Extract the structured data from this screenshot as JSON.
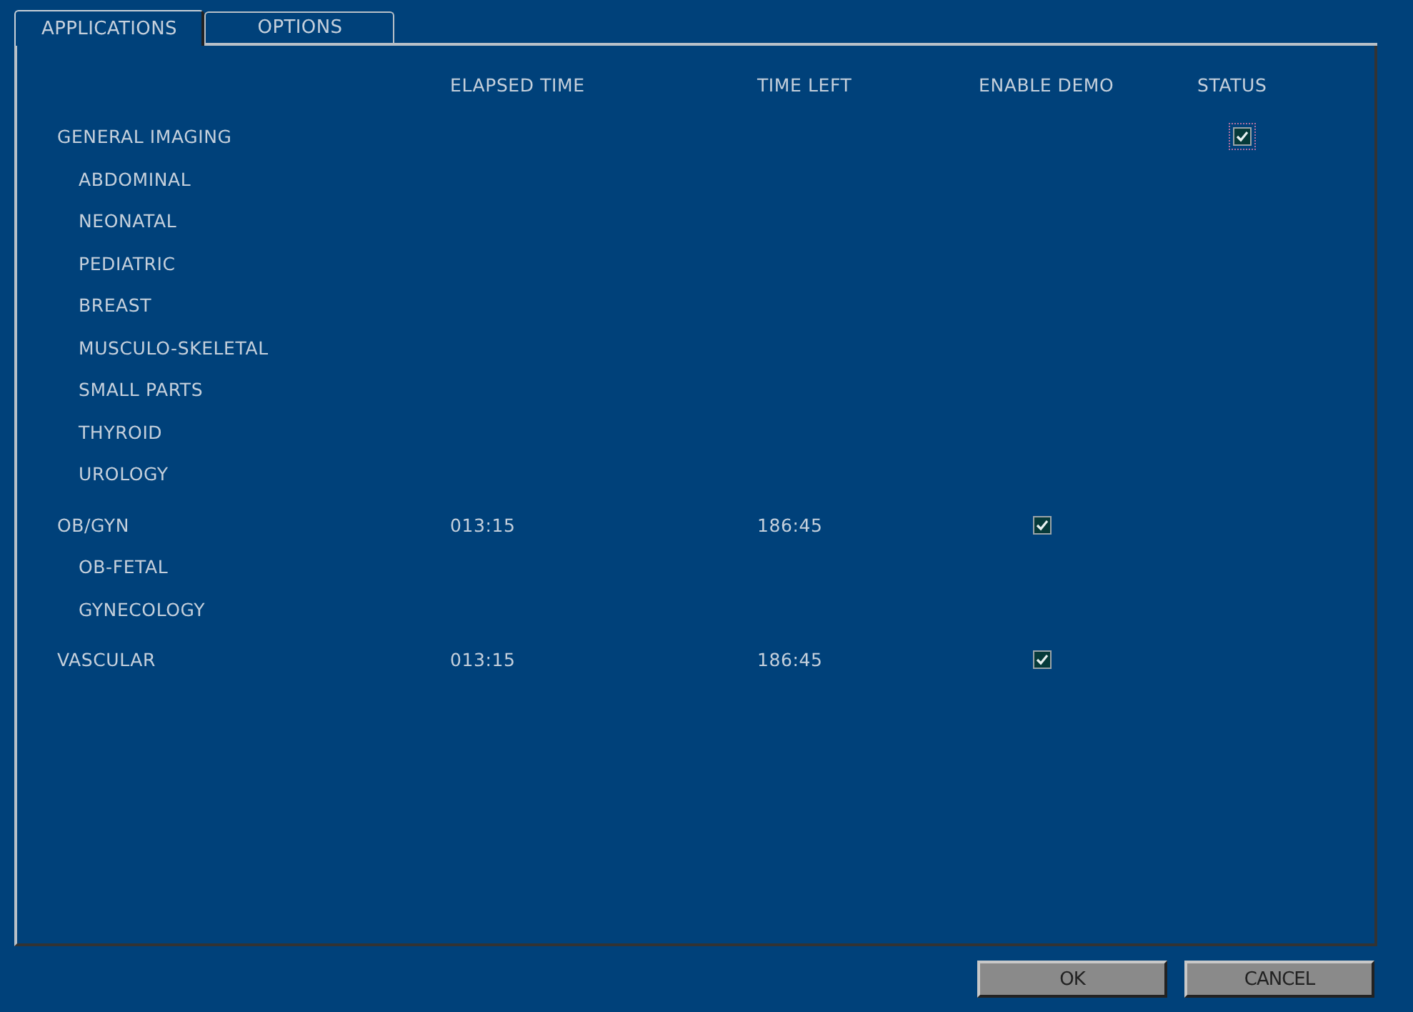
{
  "tabs": [
    {
      "label": "APPLICATIONS",
      "selected": true
    },
    {
      "label": "OPTIONS",
      "selected": false
    }
  ],
  "columns": [
    "ELAPSED TIME",
    "TIME LEFT",
    "ENABLE DEMO",
    "STATUS"
  ],
  "groups": [
    {
      "name": "GENERAL IMAGING",
      "status": {
        "checked": true,
        "focused": true
      },
      "children": [
        {
          "name": "ABDOMINAL"
        },
        {
          "name": "NEONATAL"
        },
        {
          "name": "PEDIATRIC"
        },
        {
          "name": "BREAST"
        },
        {
          "name": "MUSCULO-SKELETAL"
        },
        {
          "name": "SMALL PARTS"
        },
        {
          "name": "THYROID"
        },
        {
          "name": "UROLOGY"
        }
      ]
    },
    {
      "name": "OB/GYN",
      "elapsed": "013:15",
      "time_left": "186:45",
      "enable_demo": {
        "checked": true
      },
      "children": [
        {
          "name": "OB-FETAL"
        },
        {
          "name": "GYNECOLOGY"
        }
      ]
    },
    {
      "name": "VASCULAR",
      "elapsed": "013:15",
      "time_left": "186:45",
      "enable_demo": {
        "checked": true
      }
    }
  ],
  "buttons": [
    "OK",
    "CANCEL"
  ]
}
